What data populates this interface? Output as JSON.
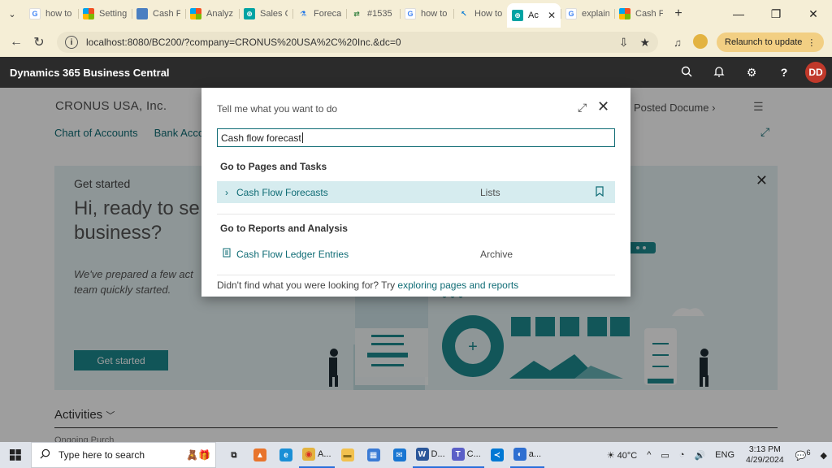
{
  "browser": {
    "tabs": [
      {
        "label": "how to",
        "favicon": "google-icon",
        "active": false
      },
      {
        "label": "Setting",
        "favicon": "microsoft-icon",
        "active": false
      },
      {
        "label": "Cash F",
        "favicon": "document-icon",
        "active": false
      },
      {
        "label": "Analyz",
        "favicon": "microsoft-icon",
        "active": false
      },
      {
        "label": "Sales C",
        "favicon": "business-central-icon",
        "active": false
      },
      {
        "label": "Foreca",
        "favicon": "flask-icon",
        "active": false
      },
      {
        "label": "#1535",
        "favicon": "pull-request-icon",
        "active": false
      },
      {
        "label": "how to",
        "favicon": "google-icon",
        "active": false
      },
      {
        "label": "How to",
        "favicon": "arrow-icon",
        "active": false
      },
      {
        "label": "Ac",
        "favicon": "business-central-icon",
        "active": true
      },
      {
        "label": "explain",
        "favicon": "google-icon",
        "active": false
      },
      {
        "label": "Cash Fl",
        "favicon": "microsoft-icon",
        "active": false
      }
    ],
    "url": "localhost:8080/BC200/?company=CRONUS%20USA%2C%20Inc.&dc=0",
    "relaunch_label": "Relaunch to update"
  },
  "app": {
    "brand": "Dynamics 365 Business Central",
    "user_initials": "DD"
  },
  "page": {
    "company": "CRONUS USA, Inc.",
    "nav_links": [
      "Chart of Accounts",
      "Bank Accou"
    ],
    "posted_docs": "Posted Docume",
    "banner": {
      "title": "Get started",
      "hero": "Hi, ready to se business?",
      "sub": "We've prepared a few act team quickly started.",
      "button": "Get started"
    },
    "activities": "Activities",
    "activities_sub": "Ongoing Purch"
  },
  "dialog": {
    "title": "Tell me what you want to do",
    "search_value": "Cash flow forecast",
    "section1": "Go to Pages and Tasks",
    "row1": {
      "name": "Cash Flow Forecasts",
      "category": "Lists"
    },
    "section2": "Go to Reports and Analysis",
    "row2": {
      "name": "Cash Flow Ledger Entries",
      "category": "Archive"
    },
    "footer_text": "Didn't find what you were looking for? Try ",
    "footer_link": "exploring pages and reports"
  },
  "taskbar": {
    "search_placeholder": "Type here to search",
    "apps": [
      {
        "name": "task-view",
        "label": ""
      },
      {
        "name": "app-orange",
        "label": ""
      },
      {
        "name": "edge",
        "label": ""
      },
      {
        "name": "chrome",
        "label": "A..."
      },
      {
        "name": "explorer",
        "label": ""
      },
      {
        "name": "store",
        "label": ""
      },
      {
        "name": "mail",
        "label": ""
      },
      {
        "name": "word",
        "label": "D..."
      },
      {
        "name": "teams",
        "label": "C..."
      },
      {
        "name": "vscode",
        "label": ""
      },
      {
        "name": "app-blue",
        "label": "a..."
      }
    ],
    "weather": "40°C",
    "language": "ENG",
    "time": "3:13 PM",
    "date": "4/29/2024",
    "notifications": "6"
  },
  "colors": {
    "accent": "#0f6c75",
    "header_bg": "#2b2b2b",
    "tab_strip": "#f5eed6",
    "avatar": "#c0392b"
  }
}
